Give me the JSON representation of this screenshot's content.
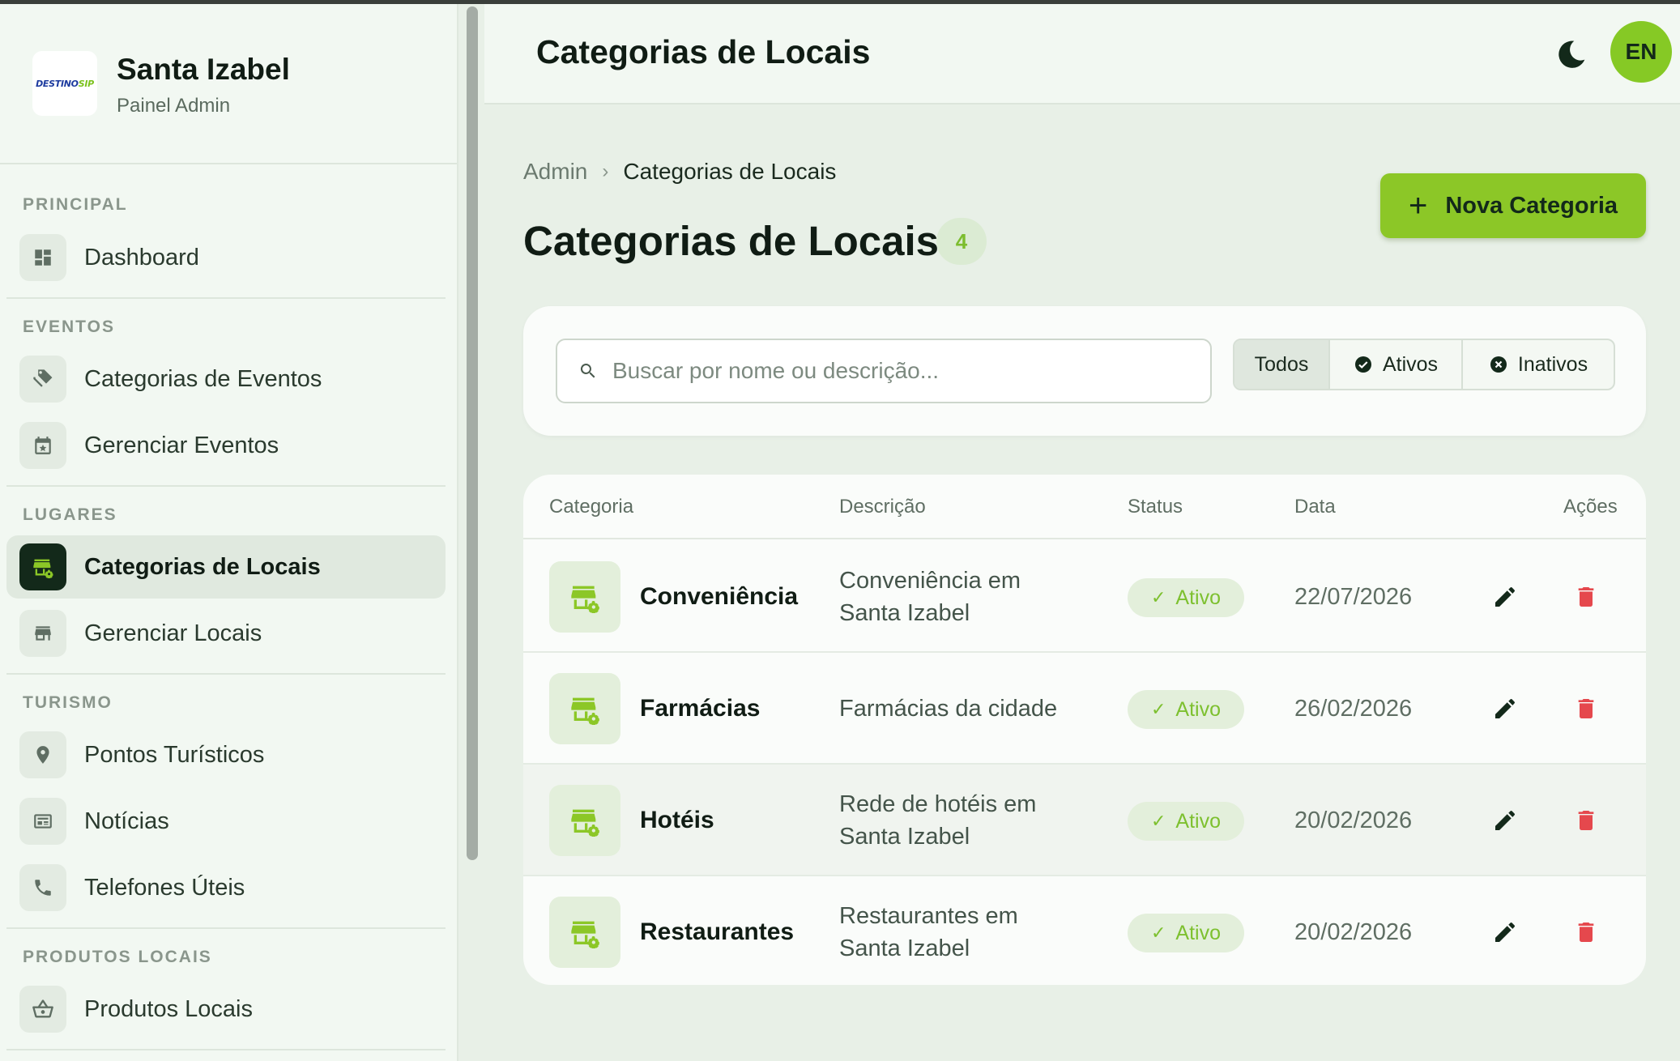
{
  "brand": {
    "title": "Santa Izabel",
    "subtitle": "Painel Admin",
    "logo_text_a": "DESTINO",
    "logo_text_b": "SIP"
  },
  "sidebar": {
    "sections": [
      {
        "label": "PRINCIPAL"
      },
      {
        "label": "EVENTOS"
      },
      {
        "label": "LUGARES"
      },
      {
        "label": "TURISMO"
      },
      {
        "label": "PRODUTOS LOCAIS"
      }
    ],
    "items": [
      {
        "label": "Dashboard",
        "icon": "dashboard-icon"
      },
      {
        "label": "Categorias de Eventos",
        "icon": "tags-icon"
      },
      {
        "label": "Gerenciar Eventos",
        "icon": "calendar-star-icon"
      },
      {
        "label": "Categorias de Locais",
        "icon": "store-settings-icon",
        "active": true
      },
      {
        "label": "Gerenciar Locais",
        "icon": "storefront-icon"
      },
      {
        "label": "Pontos Turísticos",
        "icon": "map-pin-icon"
      },
      {
        "label": "Notícias",
        "icon": "newspaper-icon"
      },
      {
        "label": "Telefones Úteis",
        "icon": "phone-icon"
      },
      {
        "label": "Produtos Locais",
        "icon": "basket-icon"
      }
    ]
  },
  "header": {
    "title": "Categorias de Locais",
    "lang": "EN",
    "theme_icon": "moon-icon"
  },
  "breadcrumb": {
    "root": "Admin",
    "current": "Categorias de Locais"
  },
  "page": {
    "title": "Categorias de Locais",
    "count": "4",
    "new_button": "Nova Categoria"
  },
  "search": {
    "placeholder": "Buscar por nome ou descrição...",
    "value": ""
  },
  "filters": {
    "all": "Todos",
    "active": "Ativos",
    "inactive": "Inativos",
    "selected": "Todos"
  },
  "table": {
    "columns": [
      "Categoria",
      "Descrição",
      "Status",
      "Data",
      "Ações"
    ],
    "rows": [
      {
        "name": "Conveniência",
        "description": "Conveniência em Santa Izabel",
        "status": "Ativo",
        "date": "22/07/2026"
      },
      {
        "name": "Farmácias",
        "description": "Farmácias da cidade",
        "status": "Ativo",
        "date": "26/02/2026"
      },
      {
        "name": "Hotéis",
        "description": "Rede de hotéis em Santa Izabel",
        "status": "Ativo",
        "date": "20/02/2026"
      },
      {
        "name": "Restaurantes",
        "description": "Restaurantes em Santa Izabel",
        "status": "Ativo",
        "date": "20/02/2026"
      }
    ]
  },
  "colors": {
    "accent": "#8cc727",
    "dark": "#13291a",
    "danger": "#e5484d",
    "success": "#7dc02f"
  }
}
